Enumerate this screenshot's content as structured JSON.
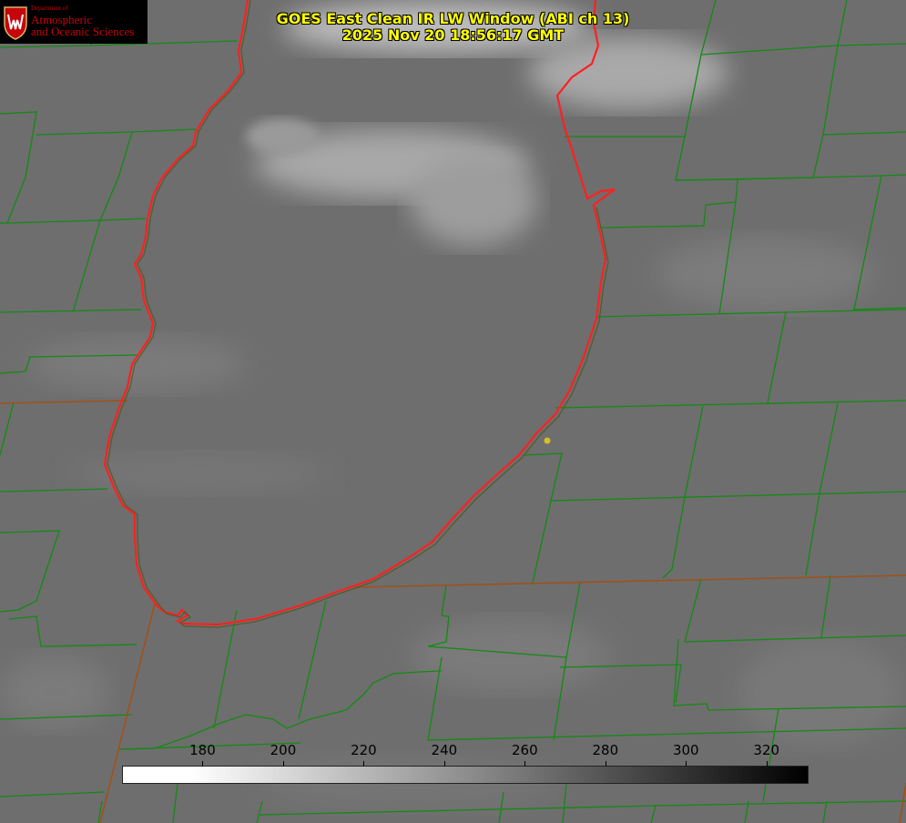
{
  "logo": {
    "dept": "Department of",
    "line1": "Atmospheric",
    "line2": "and Oceanic Sciences"
  },
  "title": {
    "line1": "GOES East Clean IR LW Window (ABI ch 13)",
    "line2": "2025 Nov 20 18:56:17 GMT"
  },
  "colorbar": {
    "min": 160,
    "max": 330,
    "ticks": [
      "180",
      "200",
      "220",
      "240",
      "260",
      "280",
      "300",
      "320"
    ],
    "gradient": [
      "#ffffff",
      "#000000"
    ]
  },
  "colors": {
    "background": "#6e6e6e",
    "county_lines": "#138a13",
    "state_lines": "#a0501a",
    "lake_outline": "#ff2020",
    "title_text": "#ffff00",
    "logo_text": "#c5050c"
  },
  "markers": [
    {
      "name": "station-marker",
      "color": "#d4c020"
    }
  ]
}
